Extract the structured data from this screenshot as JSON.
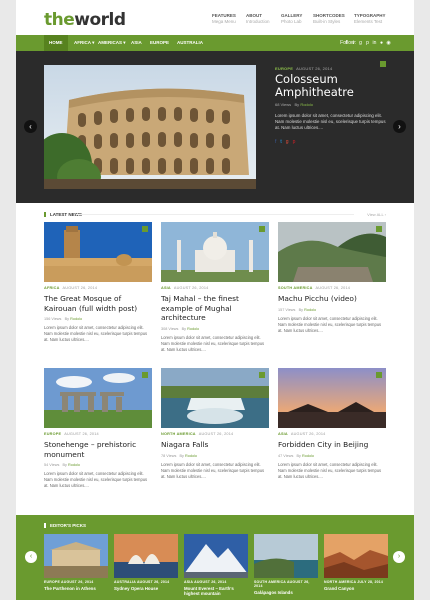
{
  "site": {
    "logo_accent": "the",
    "logo_main": "world",
    "brand_color": "#6a9a2f"
  },
  "topnav": [
    {
      "title": "FEATURES",
      "sub": "Mega Menu"
    },
    {
      "title": "ABOUT",
      "sub": "Introduction"
    },
    {
      "title": "GALLERY",
      "sub": "Photo Lab"
    },
    {
      "title": "SHORTCODES",
      "sub": "Built-in Styles"
    },
    {
      "title": "TYPOGRAPHY",
      "sub": "Elements Test"
    }
  ],
  "menu": {
    "home": "HOME",
    "africa": "AFRICA ▾",
    "americas": "AMERICAS ▾",
    "asia": "ASIA",
    "europe": "EUROPE",
    "australia": "AUSTRALIA",
    "follow": "Follow:",
    "social_icons": [
      "facebook-icon",
      "twitter-icon",
      "google-plus-icon",
      "pinterest-icon",
      "linkedin-icon",
      "dribbble-icon",
      "rss-icon"
    ]
  },
  "featured": {
    "category": "EUROPE",
    "date": "AUGUST 26, 2014",
    "title": "Colosseum Amphitheatre",
    "views": "68 Views",
    "by": "By",
    "author": "Rodolo",
    "excerpt": "Lorem ipsum dolor sit amet, consectetur adipiscing elit. Nam molestie molestie nisl eu, scelerisque turpis tempus at. Nam luctus ultrices....",
    "prev_arrow": "‹",
    "next_arrow": "›"
  },
  "latest": {
    "heading": "LATEST NEWS",
    "more": "View ALL ›",
    "posts": [
      {
        "category": "AFRICA",
        "date": "AUGUST 26, 2014",
        "title": "The Great Mosque of Kairouan (full width post)",
        "views": "156 Views",
        "by": "By",
        "author": "Rodolo",
        "excerpt": "Lorem ipsum dolor sit amet, consectetur adipiscing elit. Nam molestie molestie nisl eu, scelerisque turpis tempus at. Nam luctus ultrices...."
      },
      {
        "category": "ASIA",
        "date": "AUGUST 26, 2014",
        "title": "Taj Mahal – the finest example of Mughal architecture",
        "views": "308 Views",
        "by": "By",
        "author": "Rodolo",
        "excerpt": "Lorem ipsum dolor sit amet, consectetur adipiscing elit. Nam molestie molestie nisl eu, scelerisque turpis tempus at. Nam luctus ultrices...."
      },
      {
        "category": "SOUTH AMERICA",
        "date": "AUGUST 26, 2014",
        "title": "Machu Picchu (video)",
        "views": "157 Views",
        "by": "By",
        "author": "Rodolo",
        "excerpt": "Lorem ipsum dolor sit amet, consectetur adipiscing elit. Nam molestie molestie nisl eu, scelerisque turpis tempus at. Nam luctus ultrices...."
      },
      {
        "category": "EUROPE",
        "date": "AUGUST 26, 2014",
        "title": "Stonehenge – prehistoric monument",
        "views": "54 Views",
        "by": "By",
        "author": "Rodolo",
        "excerpt": "Lorem ipsum dolor sit amet, consectetur adipiscing elit. Nam molestie molestie nisl eu, scelerisque turpis tempus at. Nam luctus ultrices...."
      },
      {
        "category": "NORTH AMERICA",
        "date": "AUGUST 26, 2014",
        "title": "Niagara Falls",
        "views": "78 Views",
        "by": "By",
        "author": "Rodolo",
        "excerpt": "Lorem ipsum dolor sit amet, consectetur adipiscing elit. Nam molestie molestie nisl eu, scelerisque turpis tempus at. Nam luctus ultrices...."
      },
      {
        "category": "ASIA",
        "date": "AUGUST 26, 2014",
        "title": "Forbidden City in Beijing",
        "views": "47 Views",
        "by": "By",
        "author": "Rodolo",
        "excerpt": "Lorem ipsum dolor sit amet, consectetur adipiscing elit. Nam molestie molestie nisl eu, scelerisque turpis tempus at. Nam luctus ultrices...."
      }
    ]
  },
  "picks": {
    "heading": "EDITOR'S PICKS",
    "prev_arrow": "‹",
    "next_arrow": "›",
    "items": [
      {
        "category": "EUROPE",
        "date": "AUGUST 26, 2014",
        "title": "The Parthenon in Athens"
      },
      {
        "category": "AUSTRALIA",
        "date": "AUGUST 26, 2014",
        "title": "Sydney Opera House"
      },
      {
        "category": "ASIA",
        "date": "AUGUST 26, 2014",
        "title": "Mount Everest – Earth's highest mountain"
      },
      {
        "category": "SOUTH AMERICA",
        "date": "AUGUST 26, 2014",
        "title": "Galápagos Islands"
      },
      {
        "category": "NORTH AMERICA",
        "date": "JULY 28, 2014",
        "title": "Grand Canyon"
      }
    ]
  }
}
